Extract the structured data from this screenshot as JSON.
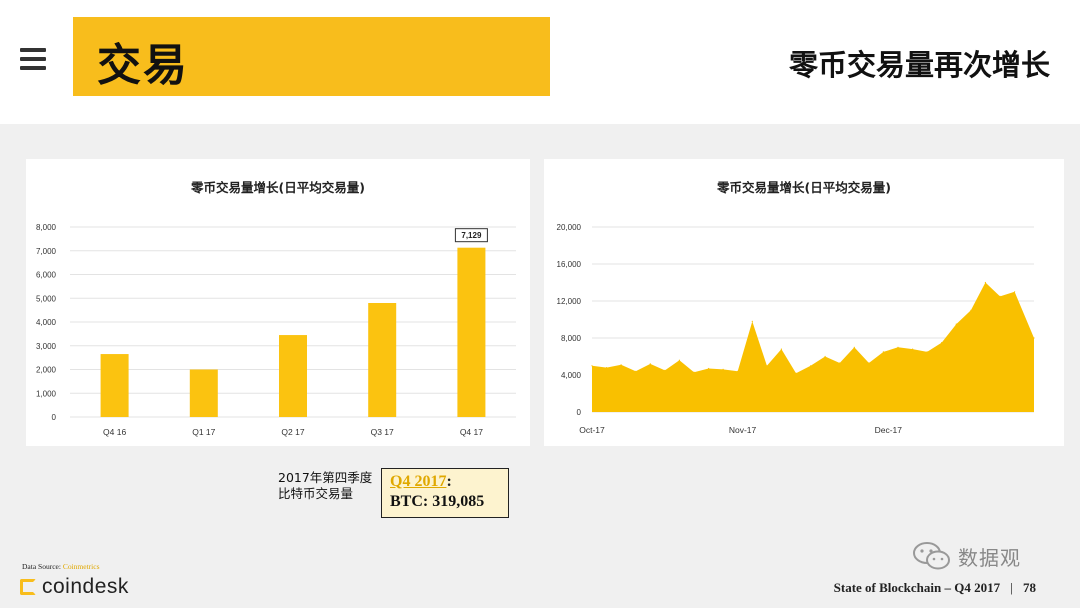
{
  "header": {
    "section_title": "交易",
    "headline": "零币交易量再次增长"
  },
  "colors": {
    "accent": "#f8bd1c",
    "bar": "#fbc310",
    "area": "#f9c000"
  },
  "chart_data": [
    {
      "type": "bar",
      "title": "零币交易量增长(日平均交易量)",
      "categories": [
        "Q4 16",
        "Q1 17",
        "Q2 17",
        "Q3 17",
        "Q4 17"
      ],
      "values": [
        2650,
        2000,
        3450,
        4800,
        7129
      ],
      "ylim": [
        0,
        8000
      ],
      "yticks": [
        0,
        1000,
        2000,
        3000,
        4000,
        5000,
        6000,
        7000,
        8000
      ],
      "ytick_labels": [
        "0",
        "1,000",
        "2,000",
        "3,000",
        "4,000",
        "5,000",
        "6,000",
        "7,000",
        "8,000"
      ],
      "annotation": {
        "category": "Q4 17",
        "text": "7,129"
      },
      "grid": true
    },
    {
      "type": "area",
      "title": "零币交易量增长(日平均交易量)",
      "x_labels": [
        "Oct-17",
        "Nov-17",
        "Dec-17"
      ],
      "x": [
        "2017-10-01",
        "2017-10-04",
        "2017-10-07",
        "2017-10-10",
        "2017-10-13",
        "2017-10-16",
        "2017-10-19",
        "2017-10-22",
        "2017-10-25",
        "2017-10-28",
        "2017-10-31",
        "2017-11-03",
        "2017-11-06",
        "2017-11-09",
        "2017-11-12",
        "2017-11-15",
        "2017-11-18",
        "2017-11-21",
        "2017-11-24",
        "2017-11-27",
        "2017-11-30",
        "2017-12-03",
        "2017-12-06",
        "2017-12-09",
        "2017-12-12",
        "2017-12-15",
        "2017-12-18",
        "2017-12-21",
        "2017-12-24",
        "2017-12-27",
        "2017-12-31"
      ],
      "values": [
        5000,
        4800,
        5100,
        4400,
        5200,
        4500,
        5600,
        4300,
        4700,
        4600,
        4400,
        9800,
        5000,
        6800,
        4200,
        5000,
        6000,
        5300,
        7000,
        5300,
        6500,
        7000,
        6800,
        6500,
        7500,
        9500,
        11000,
        14000,
        12500,
        13000,
        8000
      ],
      "ylim": [
        0,
        20000
      ],
      "yticks": [
        0,
        4000,
        8000,
        12000,
        16000,
        20000
      ],
      "ytick_labels": [
        "0",
        "4,000",
        "8,000",
        "12,000",
        "16,000",
        "20,000"
      ],
      "grid": true
    }
  ],
  "summary": {
    "label_line1": "2017年第四季度",
    "label_line2": "比特币交易量",
    "quarter": "Q4 2017",
    "colon": ":",
    "btc": "BTC: 319,085"
  },
  "footer": {
    "data_source_label": "Data Source:",
    "data_source_name": "Coinmetrics",
    "logo_text": "coindesk",
    "report": "State of Blockchain – Q4 2017",
    "separator": "|",
    "page": "78",
    "wechat_text": "数据观"
  }
}
